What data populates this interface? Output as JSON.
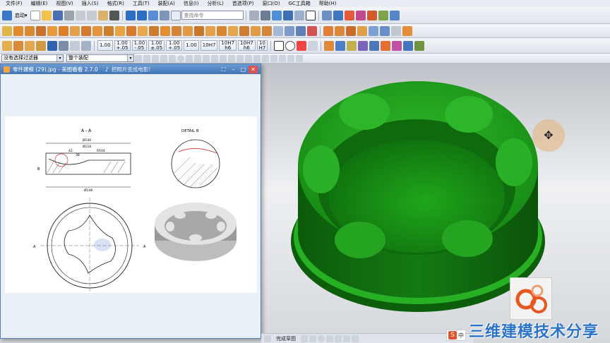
{
  "menubar": {
    "items": [
      "文件(F)",
      "编辑(E)",
      "视图(V)",
      "插入(S)",
      "格式(R)",
      "工具(T)",
      "装配(A)",
      "信息(I)",
      "分析(L)",
      "首选项(P)",
      "窗口(O)",
      "GC工具箱",
      "帮助(H)"
    ]
  },
  "toolbar": {
    "start_label": "启动▾",
    "command_search_placeholder": "查找命令",
    "dim_buttons": [
      "1.00",
      "1.00\n+.05",
      "1.00\n-.05",
      "1.00\n±.05",
      "1.00\n+.05",
      "1.00",
      "10H7",
      "10H7\nh6",
      "10H7\nh6",
      "10\nH7"
    ]
  },
  "filterbar": {
    "selection_filter": "没有选择过滤器",
    "assembly_scope": "整个装配"
  },
  "viewer": {
    "title": "零件建模 (29).jpg - 美图看看 2.7.0",
    "subtitle": "把照片变成电影!",
    "drawing": {
      "section_label": "A - A",
      "detail_label": "DETAIL B",
      "dims": [
        "Ø140",
        "Ø118",
        "42",
        "38",
        "R104",
        "Ø148"
      ],
      "marker_a": "A",
      "marker_b": "B"
    }
  },
  "bottombar": {
    "label": "完成草图"
  },
  "ime": {
    "logo": "S",
    "mode": "中"
  },
  "watermark": "三维建模技术分享",
  "colors": {
    "model_green": "#1f9a1c",
    "model_dark": "#0f6b0e",
    "accent_blue": "#2a73c9"
  }
}
